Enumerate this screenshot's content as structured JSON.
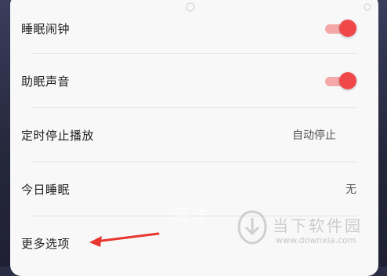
{
  "settings": {
    "rows": [
      {
        "label": "睡眠闹钟",
        "type": "toggle",
        "on": true
      },
      {
        "label": "助眠声音",
        "type": "toggle",
        "on": true
      },
      {
        "label": "定时停止播放",
        "value": "自动停止"
      },
      {
        "label": "今日睡眠",
        "value": "无"
      },
      {
        "label": "更多选项"
      }
    ]
  },
  "background_text": "海洋",
  "watermark": {
    "title": "当下软件园",
    "url": "www.downxia.com"
  },
  "colors": {
    "accent": "#f0474a",
    "toggle_track": "#f4a9a8",
    "arrow": "#e8352f",
    "panel": "#f8f8f8"
  }
}
